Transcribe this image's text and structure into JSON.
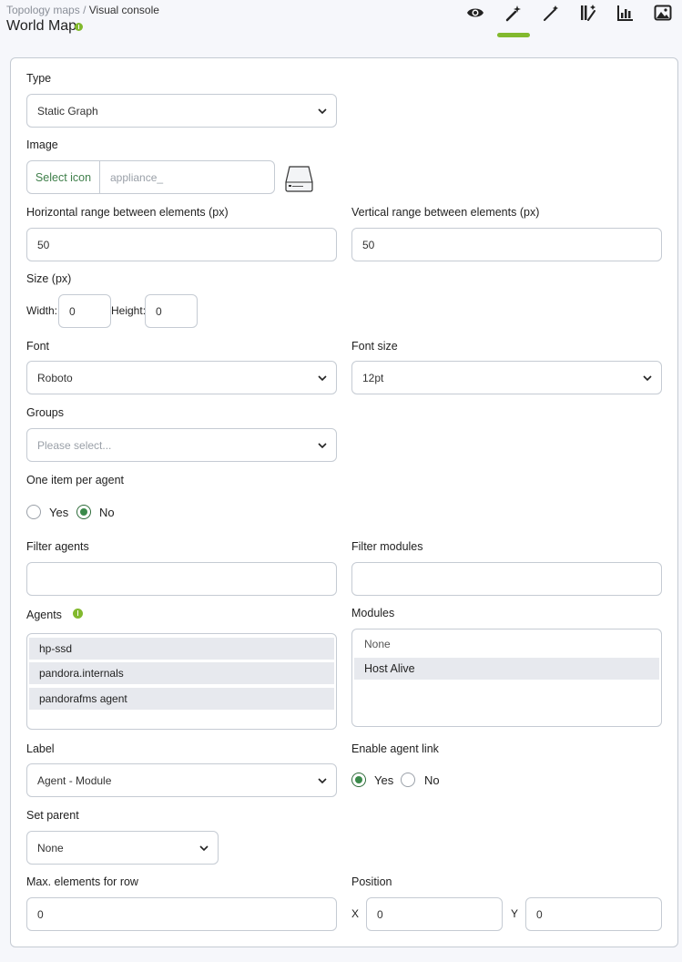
{
  "header": {
    "breadcrumb_parent": "Topology maps",
    "breadcrumb_sep": "/",
    "breadcrumb_current": "Visual console",
    "title": "World Map",
    "tools": [
      "eye-icon",
      "magic-wand-icon",
      "wand-icon",
      "sparkle-wand-icon",
      "bar-chart-icon",
      "image-icon"
    ],
    "active_tool": "magic-wand-icon",
    "accent": "#82b92e"
  },
  "form": {
    "type": {
      "label": "Type",
      "value": "Static Graph"
    },
    "image": {
      "label": "Image",
      "button": "Select icon",
      "placeholder": "appliance_"
    },
    "h_range": {
      "label": "Horizontal range between elements (px)",
      "value": "50"
    },
    "v_range": {
      "label": "Vertical range between elements (px)",
      "value": "50"
    },
    "size": {
      "label": "Size (px)",
      "width_label": "Width:",
      "width": "0",
      "height_label": "Height:",
      "height": "0"
    },
    "font": {
      "label": "Font",
      "value": "Roboto"
    },
    "font_size": {
      "label": "Font size",
      "value": "12pt"
    },
    "groups": {
      "label": "Groups",
      "placeholder": "Please select..."
    },
    "one_item": {
      "label": "One item per agent",
      "yes": "Yes",
      "no": "No",
      "selected": "No"
    },
    "filter_agents": {
      "label": "Filter agents",
      "value": ""
    },
    "filter_modules": {
      "label": "Filter modules",
      "value": ""
    },
    "agents": {
      "label": "Agents",
      "items": [
        "hp-ssd",
        "pandora.internals",
        "pandorafms agent"
      ]
    },
    "modules": {
      "label": "Modules",
      "items": [
        "None",
        "Host Alive"
      ],
      "selected": "Host Alive"
    },
    "label": {
      "label": "Label",
      "value": "Agent - Module"
    },
    "agent_link": {
      "label": "Enable agent link",
      "yes": "Yes",
      "no": "No",
      "selected": "Yes"
    },
    "parent": {
      "label": "Set parent",
      "value": "None"
    },
    "max_elements": {
      "label": "Max. elements for row",
      "value": "0"
    },
    "position": {
      "label": "Position",
      "x_label": "X",
      "x": "0",
      "y_label": "Y",
      "y": "0"
    }
  }
}
